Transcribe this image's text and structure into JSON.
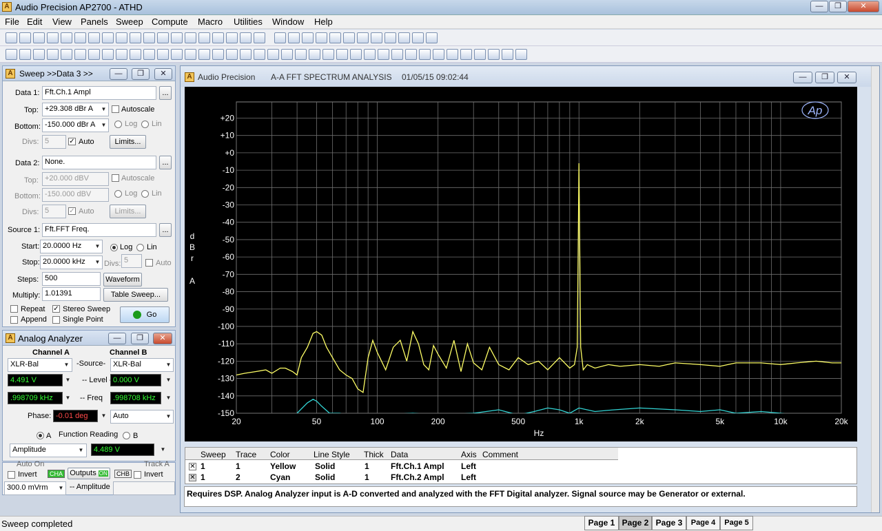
{
  "app": {
    "title": "Audio Precision AP2700 - ATHD",
    "icon": "ap-logo-icon"
  },
  "menu": [
    "File",
    "Edit",
    "View",
    "Panels",
    "Sweep",
    "Compute",
    "Macro",
    "Utilities",
    "Window",
    "Help"
  ],
  "sweep_panel": {
    "title": "Sweep >>Data 3 >>",
    "data1": {
      "label": "Data 1:",
      "value": "Fft.Ch.1 Ampl",
      "top_label": "Top:",
      "top": "+29.308  dBr A",
      "autoscale": "Autoscale",
      "bottom_label": "Bottom:",
      "bottom": "-150.000  dBr A",
      "log": "Log",
      "lin": "Lin",
      "divs_label": "Divs:",
      "divs": "5",
      "auto": "Auto",
      "limits": "Limits..."
    },
    "data2": {
      "label": "Data 2:",
      "value": "None.",
      "top_label": "Top:",
      "top": "+20.000  dBV",
      "autoscale": "Autoscale",
      "bottom_label": "Bottom:",
      "bottom": "-150.000  dBV",
      "log": "Log",
      "lin": "Lin",
      "divs_label": "Divs:",
      "divs": "5",
      "auto": "Auto",
      "limits": "Limits..."
    },
    "source1": {
      "label": "Source 1:",
      "value": "Fft.FFT Freq.",
      "start_label": "Start:",
      "start": "20.0000  Hz",
      "log": "Log",
      "lin": "Lin",
      "stop_label": "Stop:",
      "stop": "20.0000  kHz",
      "divs_label": "Divs:",
      "divs": "5",
      "auto": "Auto",
      "steps_label": "Steps:",
      "steps": "500",
      "waveform": "Waveform",
      "multiply_label": "Multiply:",
      "multiply": "1.01391",
      "table_sweep": "Table Sweep..."
    },
    "repeat": "Repeat",
    "append": "Append",
    "stereo_sweep": "Stereo Sweep",
    "single_point": "Single Point",
    "go": "Go"
  },
  "analyzer": {
    "title": "Analog Analyzer",
    "channel_a": "Channel A",
    "channel_b": "Channel B",
    "source_a": "XLR-Bal",
    "source_label": "-Source-",
    "source_b": "XLR-Bal",
    "level_a": "4.491    V",
    "level_label": "-- Level --",
    "level_b": "0.000    V",
    "freq_a": ".998709 kHz",
    "freq_label": "-- Freq",
    "freq_b": ".998708 kHz",
    "phase_label": "Phase:",
    "phase": "-0.01   deg",
    "phase_mode": "Auto",
    "radio_a": "A",
    "function_reading": "Function Reading",
    "radio_b": "B",
    "function": "Amplitude",
    "function_value": "4.489    V"
  },
  "generator": {
    "auto_on": "Auto On",
    "track_a": "Track A",
    "invert": "Invert",
    "cha": "CHA",
    "outputs": "Outputs",
    "on": "ON",
    "chb": "CHB",
    "invert2": "Invert",
    "amp": "300.0   mVrm",
    "amp_label": "-- Amplitude"
  },
  "graph_window": {
    "title": "Audio Precision",
    "subtitle": "A-A FFT SPECTRUM ANALYSIS",
    "datetime": "01/05/15 09:02:44",
    "logo": "Ap"
  },
  "chart_data": {
    "type": "line",
    "ylabel": "dBr A",
    "xlabel": "Hz",
    "ylim": [
      -150,
      29.308
    ],
    "xlim": [
      20,
      20000
    ],
    "xscale": "log",
    "grid": true,
    "y_ticks": [
      "+20",
      "+10",
      "+0",
      "-10",
      "-20",
      "-30",
      "-40",
      "-50",
      "-60",
      "-70",
      "-80",
      "-90",
      "-100",
      "-110",
      "-120",
      "-130",
      "-140",
      "-150"
    ],
    "x_ticks": [
      "20",
      "50",
      "100",
      "200",
      "500",
      "1k",
      "2k",
      "5k",
      "10k",
      "20k"
    ],
    "series": [
      {
        "name": "Fft.Ch.1 Ampl",
        "color": "#ffff66",
        "x": [
          20,
          22,
          25,
          28,
          30,
          33,
          35,
          38,
          40,
          42,
          45,
          48,
          50,
          53,
          56,
          60,
          65,
          70,
          75,
          80,
          85,
          90,
          95,
          100,
          110,
          120,
          130,
          140,
          150,
          160,
          170,
          180,
          190,
          200,
          220,
          240,
          260,
          280,
          300,
          330,
          360,
          400,
          450,
          500,
          560,
          630,
          700,
          800,
          900,
          950,
          980,
          990,
          1000,
          1010,
          1020,
          1050,
          1100,
          1200,
          1400,
          1600,
          2000,
          2500,
          3000,
          4000,
          5000,
          6000,
          8000,
          10000,
          12000,
          15000,
          18000,
          20000
        ],
        "y": [
          -128,
          -127,
          -126,
          -125,
          -127,
          -124,
          -124,
          -126,
          -128,
          -118,
          -112,
          -104,
          -103,
          -105,
          -112,
          -118,
          -125,
          -128,
          -130,
          -136,
          -138,
          -118,
          -108,
          -115,
          -125,
          -112,
          -108,
          -120,
          -103,
          -110,
          -122,
          -125,
          -111,
          -116,
          -124,
          -108,
          -126,
          -110,
          -121,
          -125,
          -112,
          -122,
          -125,
          -118,
          -122,
          -120,
          -125,
          -118,
          -124,
          -122,
          -112,
          -60,
          -6,
          -60,
          -112,
          -125,
          -122,
          -124,
          -122,
          -123,
          -122,
          -123,
          -121,
          -122,
          -123,
          -121,
          -121,
          -122,
          -121,
          -120,
          -121,
          -121
        ]
      },
      {
        "name": "Fft.Ch.2 Ampl",
        "color": "#33d6d6",
        "x": [
          40,
          45,
          48,
          50,
          53,
          58,
          65,
          70,
          100,
          150,
          200,
          300,
          400,
          500,
          600,
          700,
          800,
          900,
          1000,
          1200,
          1500,
          2000,
          3000,
          4000,
          5000,
          6000,
          8000,
          10000,
          12000,
          15000,
          20000
        ],
        "y": [
          -150,
          -144,
          -142,
          -143,
          -146,
          -150,
          -150,
          -151,
          -151,
          -150,
          -151,
          -150,
          -148,
          -151,
          -149,
          -147,
          -148,
          -150,
          -147,
          -149,
          -148,
          -147,
          -148,
          -149,
          -148,
          -150,
          -149,
          -150,
          -151,
          -151,
          -151
        ]
      }
    ]
  },
  "trace_table": {
    "headers": [
      "Sweep",
      "Trace",
      "Color",
      "Line Style",
      "Thick",
      "Data",
      "Axis",
      "Comment"
    ],
    "rows": [
      [
        "1",
        "1",
        "Yellow",
        "Solid",
        "1",
        "Fft.Ch.1 Ampl",
        "Left",
        ""
      ],
      [
        "1",
        "2",
        "Cyan",
        "Solid",
        "1",
        "Fft.Ch.2 Ampl",
        "Left",
        ""
      ]
    ]
  },
  "comment": "Requires DSP.  Analog Analyzer input is A-D converted and analyzed with the FFT Digital analyzer.  Signal source may be Generator or external.",
  "status": "Sweep completed",
  "pages": [
    "Page 1",
    "Page 2",
    "Page 3",
    "Page 4",
    "Page 5"
  ]
}
